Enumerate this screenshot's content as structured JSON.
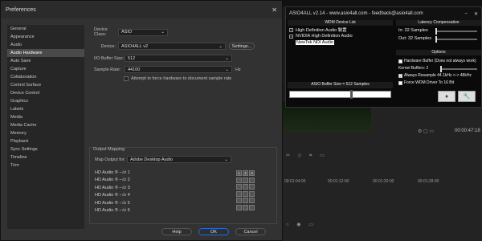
{
  "prefs": {
    "title": "Preferences",
    "categories": [
      "General",
      "Appearance",
      "Audio",
      "Audio Hardware",
      "Auto Save",
      "Capture",
      "Collaboration",
      "Control Surface",
      "Device Control",
      "Graphics",
      "Labels",
      "Media",
      "Media Cache",
      "Memory",
      "Playback",
      "Sync Settings",
      "Timeline",
      "Trim"
    ],
    "selected_category": "Audio Hardware",
    "device_class_label": "Device Class:",
    "device_class_value": "ASIO",
    "device_label": "Device:",
    "device_value": "ASIO4ALL v2",
    "settings_button": "Settings...",
    "buffer_label": "I/O Buffer Size:",
    "buffer_value": "512",
    "sample_rate_label": "Sample Rate:",
    "sample_rate_value": "44100",
    "sample_rate_unit": "Hz",
    "attempt_force_label": "Attempt to force hardware to document sample rate",
    "output_mapping_title": "Output Mapping",
    "map_output_label": "Map Output for:",
    "map_output_value": "Adobe Desktop Audio",
    "channels": [
      "HD Audio ® –√z 1",
      "HD Audio ® –√z 2",
      "HD Audio ® –√z 3",
      "HD Audio ® –√z 4",
      "HD Audio ® –√z 5",
      "HD Audio ® –√z 6"
    ],
    "help_button": "Help",
    "ok_button": "OK",
    "cancel_button": "Cancel"
  },
  "asio": {
    "title": "ASIO4ALL v2.14 - www.asio4all.com - feedback@asio4all.com",
    "wdm_header": "WDM Device List",
    "devices": [
      {
        "name": "High Definition Audio 裝置",
        "selected": false
      },
      {
        "name": "NVIDIA High Definition Audio",
        "selected": false
      },
      {
        "name": "NewTek NDI Audio",
        "selected": true
      }
    ],
    "buffer_header": "ASIO Buffer Size = 512 Samples",
    "buffer_level": 0.6,
    "latency_header": "Latency Compensation",
    "in_label": "In:",
    "in_value": "32 Samples",
    "out_label": "Out:",
    "out_value": "32 Samples",
    "options_header": "Options",
    "hw_buffer_label": "Hardware Buffer (Does not always work)",
    "kernel_label": "Kernel Buffers: 2",
    "resample_label": "Always Resample 44.1kHz <-> 48kHz",
    "force_wdm_label": "Force WDM Driver To 16 Bit"
  },
  "timeline": {
    "timecode": "00:00:47:18",
    "ruler": [
      "00:01:04:00",
      "00:01:12:00",
      "00:01:20:00",
      "00:01:28:00"
    ]
  }
}
